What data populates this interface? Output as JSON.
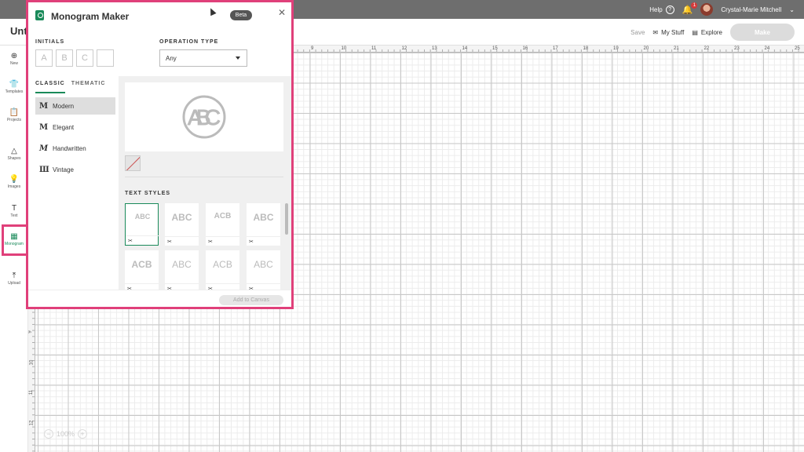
{
  "topbar": {
    "help_label": "Help",
    "help_icon": "?",
    "notification_count": "1",
    "user_name": "Crystal-Marie Mitchell",
    "dropdown_icon": "⌄"
  },
  "subbar": {
    "doc_title": "Unti",
    "save_label": "Save",
    "my_stuff_label": "My Stuff",
    "explore_label": "Explore",
    "make_label": "Make"
  },
  "sidebar": {
    "items": [
      {
        "label": "New",
        "icon": "⊕"
      },
      {
        "label": "Templates",
        "icon": "👕"
      },
      {
        "label": "Projects",
        "icon": "📋"
      },
      {
        "label": "Shapes",
        "icon": "△"
      },
      {
        "label": "Images",
        "icon": "💡"
      },
      {
        "label": "Text",
        "icon": "T"
      },
      {
        "label": "Monogram",
        "icon": "▦"
      },
      {
        "label": "Upload",
        "icon": "⤒"
      }
    ]
  },
  "ruler": {
    "top_ticks": [
      "9",
      "10",
      "11",
      "12",
      "13",
      "14",
      "15",
      "16",
      "17",
      "18",
      "19",
      "20",
      "21",
      "22",
      "23",
      "24",
      "25"
    ],
    "left_ticks": [
      "9",
      "10",
      "11",
      "12"
    ]
  },
  "zoom": {
    "minus": "−",
    "value": "100%",
    "plus": "+"
  },
  "panel": {
    "title": "Monogram Maker",
    "badge": "Beta",
    "close_icon": "✕",
    "initials_label": "INITIALS",
    "initials": [
      "A",
      "B",
      "C",
      ""
    ],
    "operation_label": "OPERATION TYPE",
    "operation_value": "Any",
    "tabs": [
      "CLASSIC",
      "THEMATIC"
    ],
    "fonts": [
      {
        "icon": "M",
        "label": "Modern"
      },
      {
        "icon": "M",
        "label": "Elegant"
      },
      {
        "icon": "M",
        "label": "Handwritten"
      },
      {
        "icon": "Ш",
        "label": "Vintage"
      }
    ],
    "preview_text": "ABC",
    "text_styles_label": "TEXT STYLES",
    "styles": [
      {
        "text": "ABC"
      },
      {
        "text": "ABC"
      },
      {
        "text": "ACB"
      },
      {
        "text": "ABC"
      },
      {
        "text": "ACB"
      },
      {
        "text": "ABC"
      },
      {
        "text": "ACB"
      },
      {
        "text": "ABC"
      }
    ],
    "cut_icon": "✂",
    "add_button": "Add to Canvas"
  }
}
